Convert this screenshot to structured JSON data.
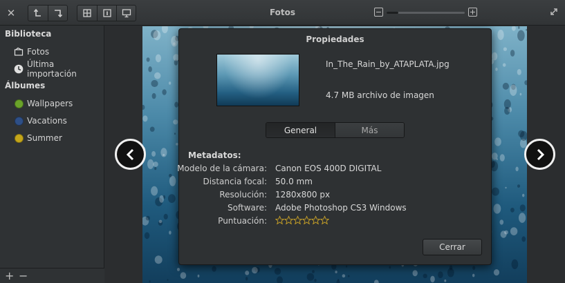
{
  "header": {
    "title": "Fotos",
    "close_icon": "close-icon",
    "rotate_left_icon": "rotate-left-icon",
    "rotate_right_icon": "rotate-right-icon",
    "view_icons": [
      "grid-icon",
      "info-icon",
      "slideshow-icon"
    ],
    "zoom_level": 0.15,
    "fullscreen_icon": "fullscreen-icon"
  },
  "sidebar": {
    "library_heading": "Biblioteca",
    "library_items": [
      {
        "label": "Fotos",
        "icon": "photos-icon"
      },
      {
        "label": "Última importación",
        "icon": "clock-icon"
      }
    ],
    "albums_heading": "Álbumes",
    "albums": [
      {
        "label": "Wallpapers",
        "color": "#6aa32a"
      },
      {
        "label": "Vacations",
        "color": "#2e4f86"
      },
      {
        "label": "Summer",
        "color": "#c4a61a"
      }
    ],
    "add_label": "+",
    "remove_label": "−"
  },
  "viewer": {
    "prev_icon": "chevron-left-icon",
    "next_icon": "chevron-right-icon"
  },
  "dialog": {
    "title": "Propiedades",
    "filename": "In_The_Rain_by_ATAPLATA.jpg",
    "filesize": "4.7 MB archivo de imagen",
    "tabs": [
      {
        "label": "General",
        "active": true
      },
      {
        "label": "Más",
        "active": false
      }
    ],
    "metadata_heading": "Metadatos:",
    "metadata": [
      {
        "label": "Modelo de la cámara:",
        "value": "Canon EOS 400D DIGITAL"
      },
      {
        "label": "Distancia focal:",
        "value": "50.0 mm"
      },
      {
        "label": "Resolución:",
        "value": "1280x800 px"
      },
      {
        "label": "Software:",
        "value": "Adobe Photoshop CS3 Windows"
      }
    ],
    "rating_label": "Puntuación:",
    "rating": 0,
    "rating_max": 6,
    "close_label": "Cerrar"
  },
  "colors": {
    "star": "#c9a227",
    "accent": "#ffffff"
  }
}
